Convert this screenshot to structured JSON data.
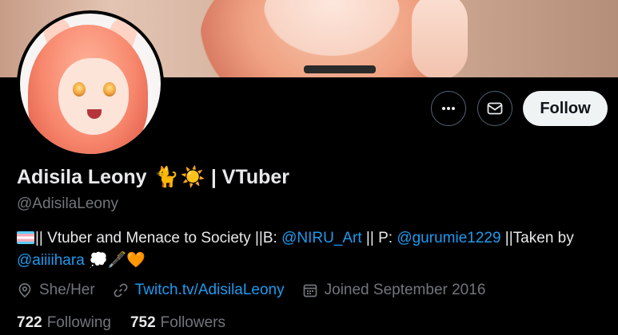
{
  "profile": {
    "name": "Adisila Leony",
    "name_emojis": [
      "🐈",
      "☀️"
    ],
    "name_suffix": "| VTuber",
    "handle": "@AdisilaLeony",
    "bio": {
      "part1": "|| Vtuber and Menace to Society ||B: ",
      "mention1": "@NIRU_Art",
      "part2": " || P: ",
      "mention2": "@gurumie1229",
      "part3": " ||Taken by",
      "mention3": "@aiiiihara",
      "emojis_end": "💭🖋️🧡"
    },
    "pronouns": "She/Her",
    "website": "Twitch.tv/AdisilaLeony",
    "joined": "Joined September 2016",
    "following_count": "722",
    "following_label": "Following",
    "followers_count": "752",
    "followers_label": "Followers"
  },
  "actions": {
    "more_icon": "more-horizontal-icon",
    "message_icon": "mail-icon",
    "follow_label": "Follow"
  },
  "colors": {
    "background": "#000000",
    "link": "#1d9bf0",
    "muted": "#71767b",
    "follow_bg": "#eff3f4"
  }
}
